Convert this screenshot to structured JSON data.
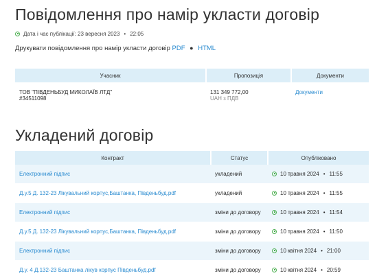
{
  "notice": {
    "title": "Повідомлення про намір укласти договір",
    "publication_label": "Дата і час публікації: 23 вересня 2023",
    "publication_time": "22:05",
    "print_label": "Друкувати повідомлення про намір укласти договір",
    "print_pdf": "PDF",
    "print_sep": "●",
    "print_html": "HTML"
  },
  "participants_table": {
    "headers": [
      "Учасник",
      "Пропозиція",
      "Документи"
    ],
    "rows": [
      {
        "name": "ТОВ \"ПІВДЕНЬБУД МИКОЛАЇВ ЛТД\"",
        "code": "#34511098",
        "amount": "131 349 772,00",
        "currency": "UAH з ПДВ",
        "documents_link": "Документи"
      }
    ]
  },
  "contract": {
    "title": "Укладений договір",
    "headers": [
      "Контракт",
      "Статус",
      "Опубліковано"
    ],
    "rows": [
      {
        "name": "Електронний підпис",
        "status": "укладений",
        "date": "10 травня 2024",
        "time": "11:55"
      },
      {
        "name": "Д.у.5 Д. 132-23 Лікувальний корпус,Баштанка, Південьбуд.pdf",
        "status": "укладений",
        "date": "10 травня 2024",
        "time": "11:55"
      },
      {
        "name": "Електронний підпис",
        "status": "зміни до договору",
        "date": "10 травня 2024",
        "time": "11:54"
      },
      {
        "name": "Д.у.5 Д. 132-23 Лікувальний корпус,Баштанка, Південьбуд.pdf",
        "status": "зміни до договору",
        "date": "10 травня 2024",
        "time": "11:50"
      },
      {
        "name": "Електронний підпис",
        "status": "зміни до договору",
        "date": "10 квітня 2024",
        "time": "21:00"
      },
      {
        "name": "Д.у. 4 Д.132-23 Баштанка лікув корпус Південьбуд.pdf",
        "status": "зміни до договору",
        "date": "10 квітня 2024",
        "time": "20:59"
      }
    ]
  },
  "colors": {
    "link": "#2a8bd0",
    "header_bg": "#dceef8",
    "row_alt_bg": "#ebf5fb",
    "clock_icon": "#4caf50"
  }
}
